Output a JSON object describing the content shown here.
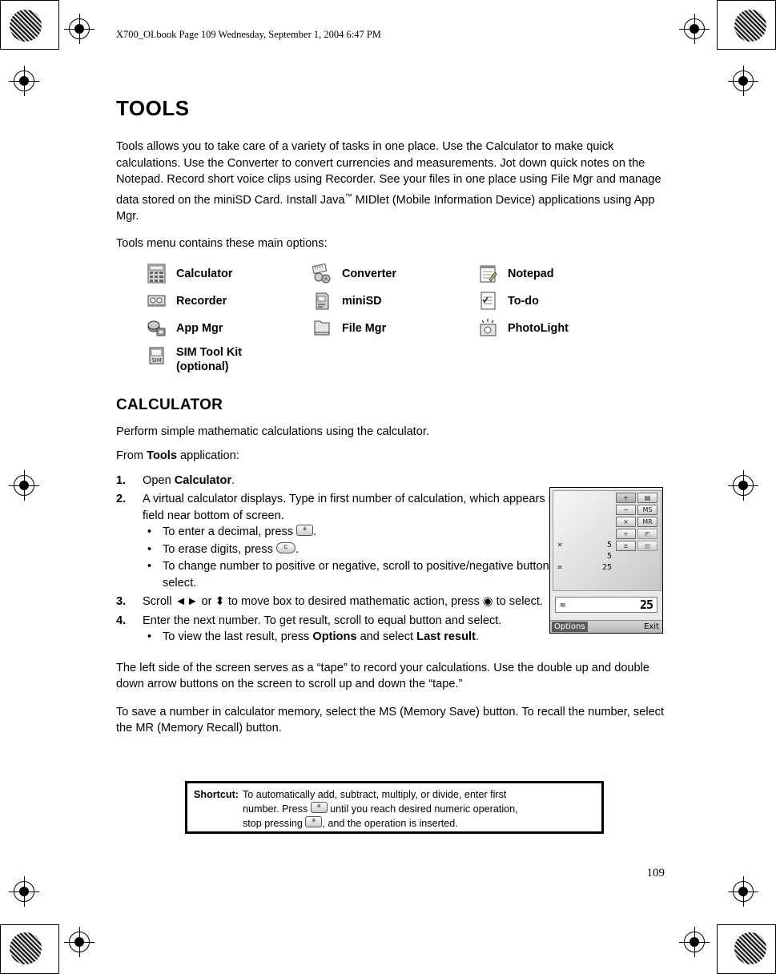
{
  "header": {
    "file_line": "X700_OI.book  Page 109  Wednesday, September 1, 2004  6:47 PM"
  },
  "page": {
    "title": "TOOLS",
    "number": "109",
    "intro": "Tools allows you to take care of a variety of tasks in one place. Use the Calculator to make quick calculations. Use the Converter to convert currencies and measurements. Jot down quick notes on the Notepad. Record short voice clips using Recorder. See your files in one place using File Mgr and manage data stored on the miniSD Card. Install Java™ MIDlet (Mobile Information Device) applications using App Mgr.",
    "menu_lead": "Tools menu contains these main options:"
  },
  "tools": [
    {
      "icon": "calculator-icon",
      "label": "Calculator"
    },
    {
      "icon": "converter-icon",
      "label": "Converter"
    },
    {
      "icon": "notepad-icon",
      "label": "Notepad"
    },
    {
      "icon": "recorder-icon",
      "label": "Recorder"
    },
    {
      "icon": "minisd-icon",
      "label": "miniSD"
    },
    {
      "icon": "todo-icon",
      "label": "To-do"
    },
    {
      "icon": "appmgr-icon",
      "label": "App Mgr"
    },
    {
      "icon": "filemgr-icon",
      "label": "File Mgr"
    },
    {
      "icon": "photolight-icon",
      "label": "PhotoLight"
    },
    {
      "icon": "simtoolkit-icon",
      "label": "SIM Tool Kit (optional)",
      "label_line1": "SIM Tool Kit",
      "label_line2": "(optional)"
    }
  ],
  "calculator": {
    "title": "CALCULATOR",
    "intro": "Perform simple mathematic calculations using the calculator.",
    "from_line_prefix": "From ",
    "from_line_bold": "Tools",
    "from_line_suffix": " application:",
    "steps": [
      {
        "num": "1.",
        "text_prefix": "Open ",
        "text_bold": "Calculator",
        "text_suffix": "."
      },
      {
        "num": "2.",
        "text": "A virtual calculator displays. Type in first number of calculation, which appears in field near bottom of screen.",
        "bullets": [
          {
            "prefix": "To enter a decimal, press ",
            "key": "star-key",
            "suffix": "."
          },
          {
            "prefix": "To erase digits, press ",
            "key": "clear-key",
            "suffix": "."
          },
          {
            "prefix": "To change number to positive or negative, scroll to positive/negative button and select.",
            "key": null,
            "suffix": ""
          }
        ]
      },
      {
        "num": "3.",
        "text_a": "Scroll ",
        "text_b": " or ",
        "text_c": " to move box to desired mathematic action, press ",
        "text_d": " to select."
      },
      {
        "num": "4.",
        "text": "Enter the next number. To get result, scroll to equal button and select.",
        "bullets": [
          {
            "prefix": "To view the last result, press ",
            "bold1": "Options",
            "mid": " and select ",
            "bold2": "Last result",
            "suffix": "."
          }
        ]
      }
    ],
    "para_tape": "The left side of the screen serves as a “tape” to record your calculations. Use the double up and double down arrow buttons on the screen to scroll up and down the “tape.”",
    "para_memory": "To save a number in calculator memory, select the MS (Memory Save) button. To recall the number, select the MR (Memory Recall) button."
  },
  "shortcut": {
    "label": "Shortcut",
    "colon": ":",
    "line1": "To automatically add, subtract, multiply, or divide, enter first",
    "line2_a": "number. Press ",
    "line2_b": " until you reach desired numeric operation,",
    "line3_a": "stop pressing ",
    "line3_b": ", and the operation is inserted."
  },
  "phone_screen": {
    "tape": [
      {
        "op": "×",
        "value": "5"
      },
      {
        "op": "",
        "value": "5"
      },
      {
        "op": "=",
        "value": "25"
      }
    ],
    "keys": [
      [
        "+",
        "▤"
      ],
      [
        "−",
        "MS"
      ],
      [
        "×",
        "MR"
      ],
      [
        "÷",
        "◩"
      ],
      [
        "±",
        "▩"
      ]
    ],
    "result_symbol": "=",
    "result_value": "25",
    "softkey_left": "Options",
    "softkey_right": "Exit"
  }
}
